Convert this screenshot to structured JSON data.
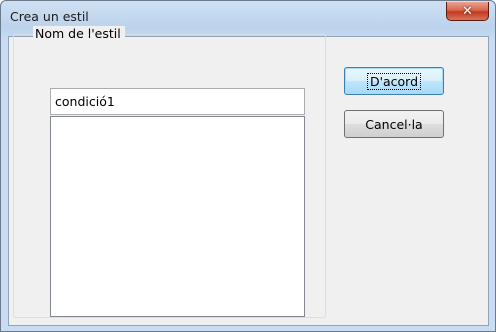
{
  "window": {
    "title": "Crea un estil",
    "close_glyph": "✕"
  },
  "group": {
    "legend": "Nom de l'estil"
  },
  "name_field": {
    "value": "condició1"
  },
  "buttons": {
    "ok_label": "D'acord",
    "cancel_label": "Cancel·la"
  },
  "style_list": {
    "items": []
  },
  "colors": {
    "titlebar": "#bcd3ec",
    "client_bg": "#f0f0f0",
    "close_button": "#c2391f",
    "default_button_border": "#3c7fb1"
  }
}
